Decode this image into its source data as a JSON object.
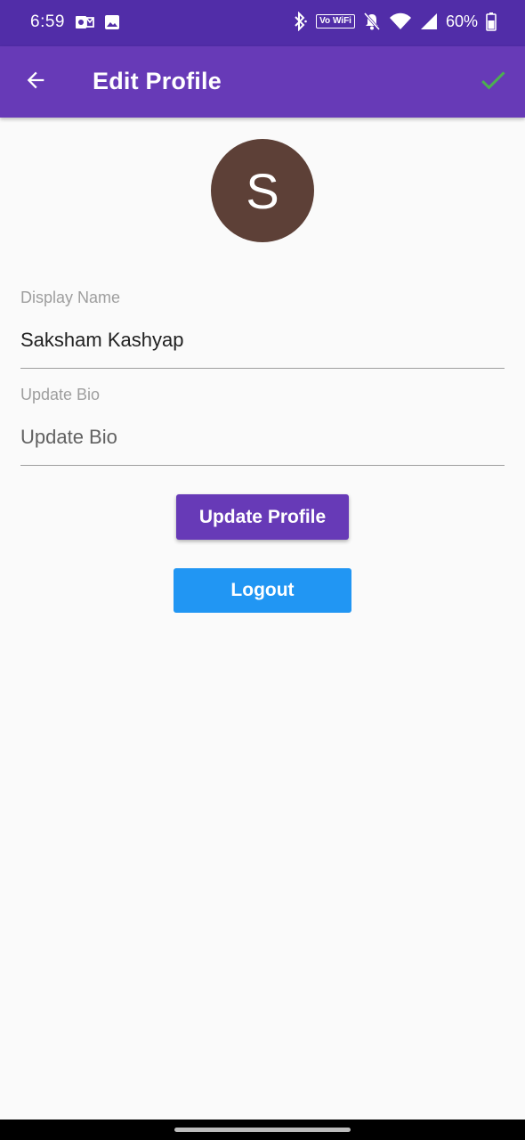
{
  "status_bar": {
    "time": "6:59",
    "network_badge": "Vo WiFi",
    "battery": "60%",
    "icons": [
      "outlook-icon",
      "image-icon",
      "bluetooth-icon",
      "vowifi-icon",
      "silent-icon",
      "wifi-icon",
      "signal-icon",
      "battery-icon"
    ]
  },
  "app_bar": {
    "title": "Edit Profile",
    "back_icon": "arrow-back-icon",
    "confirm_icon": "check-icon",
    "confirm_color": "#4caf50"
  },
  "profile": {
    "avatar_letter": "S",
    "avatar_color": "#5d4037"
  },
  "form": {
    "display_name": {
      "label": "Display Name",
      "value": "Saksham Kashyap"
    },
    "bio": {
      "label": "Update Bio",
      "placeholder": "Update Bio",
      "value": ""
    }
  },
  "buttons": {
    "update_profile": "Update Profile",
    "logout": "Logout"
  },
  "colors": {
    "app_bar": "#673ab7",
    "status_bar": "#512da8",
    "update_button": "#673ab7",
    "logout_button": "#2196f3"
  }
}
